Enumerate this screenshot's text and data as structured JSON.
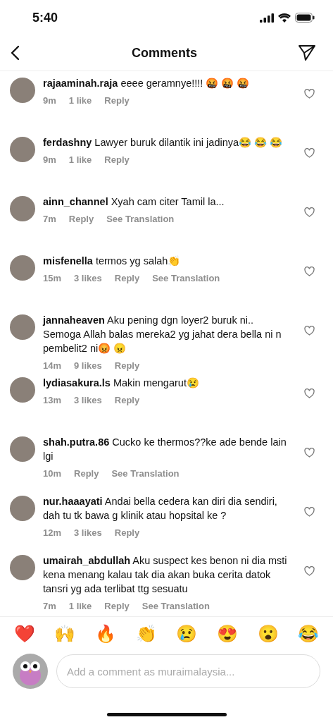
{
  "status_bar": {
    "time": "5:40"
  },
  "header": {
    "title": "Comments"
  },
  "comments": [
    {
      "username": "rajaaminah.raja",
      "text": "eeee geramnye!!!! 🤬 🤬 🤬",
      "time": "9m",
      "likes": "1 like",
      "reply": "Reply"
    },
    {
      "username": "ferdashny",
      "text": "Lawyer buruk dilantik ini jadinya😂 😂 😂",
      "time": "9m",
      "likes": "1 like",
      "reply": "Reply"
    },
    {
      "username": "ainn_channel",
      "text": "Xyah cam citer Tamil la...",
      "time": "7m",
      "reply": "Reply",
      "translation": "See Translation"
    },
    {
      "username": "misfenella",
      "text": "termos yg salah👏",
      "time": "15m",
      "likes": "3 likes",
      "reply": "Reply",
      "translation": "See Translation"
    },
    {
      "username": "jannaheaven",
      "text": "Aku pening dgn loyer2 buruk ni.. Semoga Allah balas mereka2 yg jahat dera bella ni n pembelit2 ni😡 😠",
      "time": "14m",
      "likes": "9 likes",
      "reply": "Reply"
    },
    {
      "username": "lydiasakura.ls",
      "text": "Makin mengarut😢",
      "time": "13m",
      "likes": "3 likes",
      "reply": "Reply"
    },
    {
      "username": "shah.putra.86",
      "text": "Cucko ke thermos??ke ade bende lain lgi",
      "time": "10m",
      "reply": "Reply",
      "translation": "See Translation"
    },
    {
      "username": "nur.haaayati",
      "text": "Andai bella cedera kan diri dia sendiri, dah tu tk bawa g klinik atau hopsital ke ?",
      "time": "12m",
      "likes": "3 likes",
      "reply": "Reply"
    },
    {
      "username": "umairah_abdullah",
      "text": "Aku suspect kes benon ni dia msti kena menang kalau tak dia akan buka cerita datok tansri yg ada terlibat ttg sesuatu",
      "time": "7m",
      "likes": "1 like",
      "reply": "Reply",
      "translation": "See Translation"
    }
  ],
  "reactions": [
    "❤️",
    "🙌",
    "🔥",
    "👏",
    "😢",
    "😍",
    "😮",
    "😂"
  ],
  "composer": {
    "placeholder": "Add a comment as muraimalaysia..."
  }
}
